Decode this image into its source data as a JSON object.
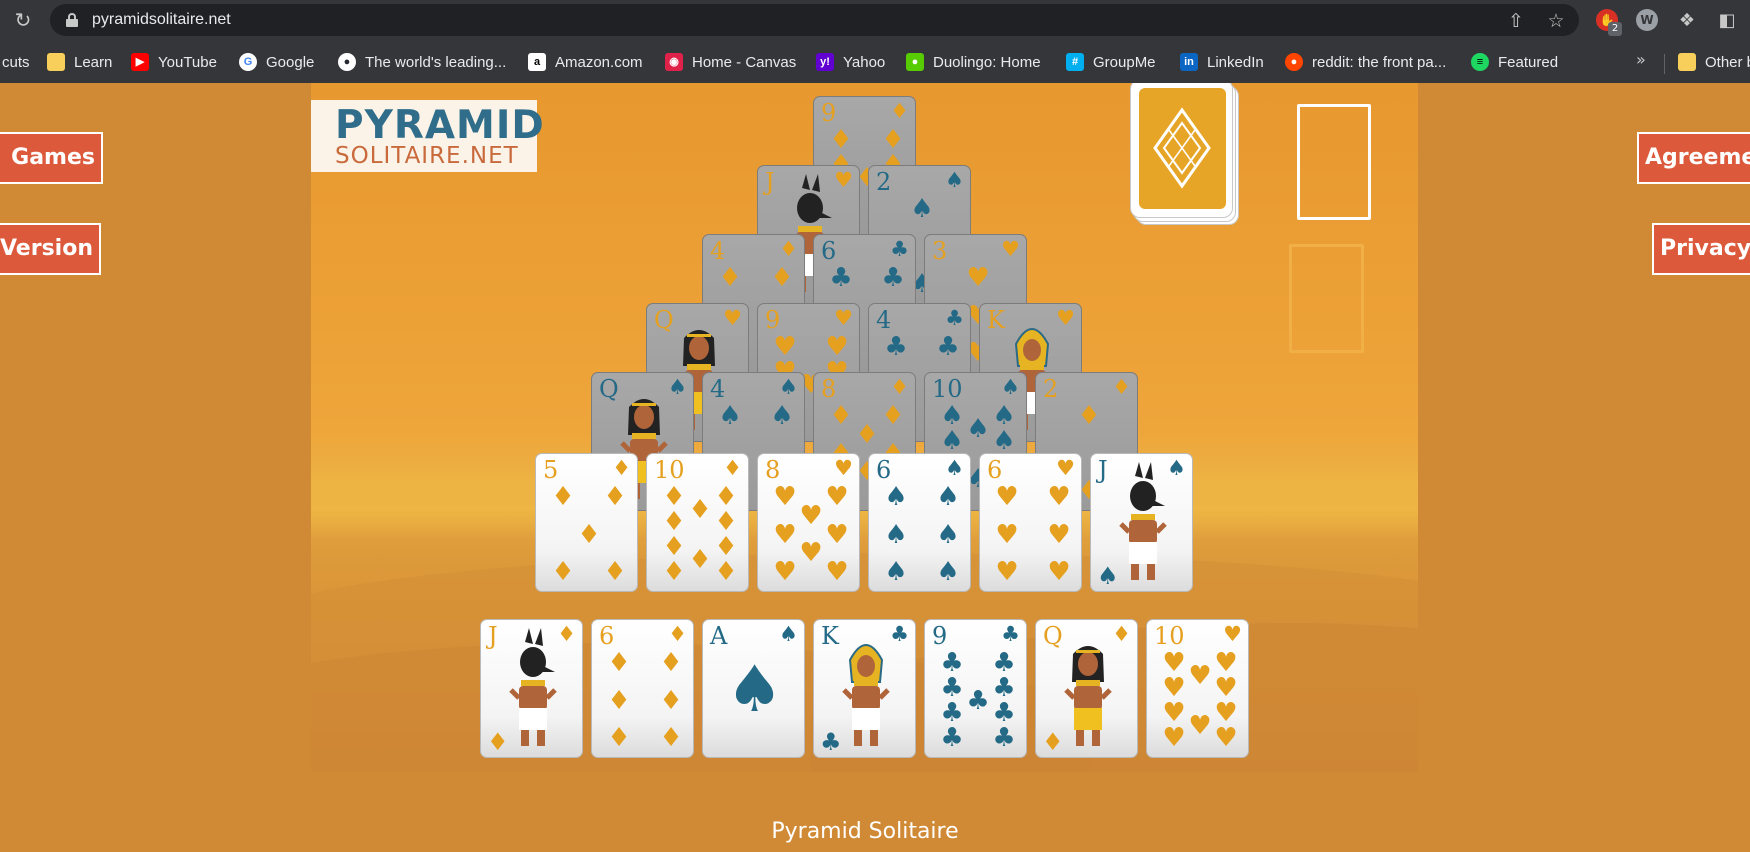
{
  "browser": {
    "url": "pyramidsolitaire.net",
    "extension_badge": "2",
    "bookmarks": [
      {
        "label": "cuts",
        "icon": "apps-icon",
        "color": "#35363a"
      },
      {
        "label": "Learn",
        "icon": "folder-icon",
        "color": "#f9cf5b"
      },
      {
        "label": "YouTube",
        "icon": "youtube-icon",
        "color": "#ff0000"
      },
      {
        "label": "Google",
        "icon": "google-icon",
        "color": "#ffffff"
      },
      {
        "label": "The world's leading...",
        "icon": "github-icon",
        "color": "#ffffff"
      },
      {
        "label": "Amazon.com",
        "icon": "amazon-icon",
        "color": "#ffffff"
      },
      {
        "label": "Home - Canvas",
        "icon": "canvas-icon",
        "color": "#e0224a"
      },
      {
        "label": "Yahoo",
        "icon": "yahoo-icon",
        "color": "#6001d2"
      },
      {
        "label": "Duolingo: Home",
        "icon": "duolingo-icon",
        "color": "#58cc02"
      },
      {
        "label": "GroupMe",
        "icon": "groupme-icon",
        "color": "#00aff0"
      },
      {
        "label": "LinkedIn",
        "icon": "linkedin-icon",
        "color": "#0a66c2"
      },
      {
        "label": "reddit: the front pa...",
        "icon": "reddit-icon",
        "color": "#ff4500"
      },
      {
        "label": "Featured",
        "icon": "spotify-icon",
        "color": "#1ed760"
      }
    ],
    "other_bookmarks": "Other b"
  },
  "page": {
    "logo_top": "PYRAMID",
    "logo_bottom": "SOLITAIRE.NET",
    "left_buttons": [
      "Games",
      "Version"
    ],
    "right_buttons": [
      "Agreeme",
      "Privacy"
    ],
    "footer_title": "Pyramid Solitaire"
  },
  "colors": {
    "background": "#d08a35",
    "button": "#dc5a3b",
    "red_suit": "#e6a020",
    "black_suit": "#246a86"
  },
  "game": {
    "pyramid": [
      [
        {
          "rank": "9",
          "suit": "♦",
          "color": "red",
          "covered": true
        }
      ],
      [
        {
          "rank": "J",
          "suit": "♥",
          "color": "red",
          "covered": true
        },
        {
          "rank": "2",
          "suit": "♠",
          "color": "black",
          "covered": true
        }
      ],
      [
        {
          "rank": "4",
          "suit": "♦",
          "color": "red",
          "covered": true
        },
        {
          "rank": "6",
          "suit": "♣",
          "color": "black",
          "covered": true
        },
        {
          "rank": "3",
          "suit": "♥",
          "color": "red",
          "covered": true
        }
      ],
      [
        {
          "rank": "Q",
          "suit": "♥",
          "color": "red",
          "covered": true
        },
        {
          "rank": "9",
          "suit": "♥",
          "color": "red",
          "covered": true
        },
        {
          "rank": "4",
          "suit": "♣",
          "color": "black",
          "covered": true
        },
        {
          "rank": "K",
          "suit": "♥",
          "color": "red",
          "covered": true
        }
      ],
      [
        {
          "rank": "Q",
          "suit": "♠",
          "color": "black",
          "covered": true
        },
        {
          "rank": "4",
          "suit": "♠",
          "color": "black",
          "covered": true
        },
        {
          "rank": "8",
          "suit": "♦",
          "color": "red",
          "covered": true
        },
        {
          "rank": "10",
          "suit": "♠",
          "color": "black",
          "covered": true
        },
        {
          "rank": "2",
          "suit": "♦",
          "color": "red",
          "covered": true
        }
      ],
      [
        {
          "rank": "5",
          "suit": "♦",
          "color": "red",
          "covered": false
        },
        {
          "rank": "10",
          "suit": "♦",
          "color": "red",
          "covered": false
        },
        {
          "rank": "8",
          "suit": "♥",
          "color": "red",
          "covered": false
        },
        {
          "rank": "6",
          "suit": "♠",
          "color": "black",
          "covered": false
        },
        {
          "rank": "6",
          "suit": "♥",
          "color": "red",
          "covered": false
        },
        {
          "rank": "J",
          "suit": "♠",
          "color": "black",
          "covered": false
        }
      ],
      [
        {
          "rank": "J",
          "suit": "♦",
          "color": "red",
          "covered": false
        },
        {
          "rank": "6",
          "suit": "♦",
          "color": "red",
          "covered": false
        },
        {
          "rank": "A",
          "suit": "♠",
          "color": "black",
          "covered": false
        },
        {
          "rank": "K",
          "suit": "♣",
          "color": "black",
          "covered": false
        },
        {
          "rank": "9",
          "suit": "♣",
          "color": "black",
          "covered": false
        },
        {
          "rank": "Q",
          "suit": "♦",
          "color": "red",
          "covered": false
        },
        {
          "rank": "10",
          "suit": "♥",
          "color": "red",
          "covered": false
        }
      ]
    ],
    "stock": "card-back",
    "waste_slot": "empty",
    "discard_slot": "empty"
  }
}
